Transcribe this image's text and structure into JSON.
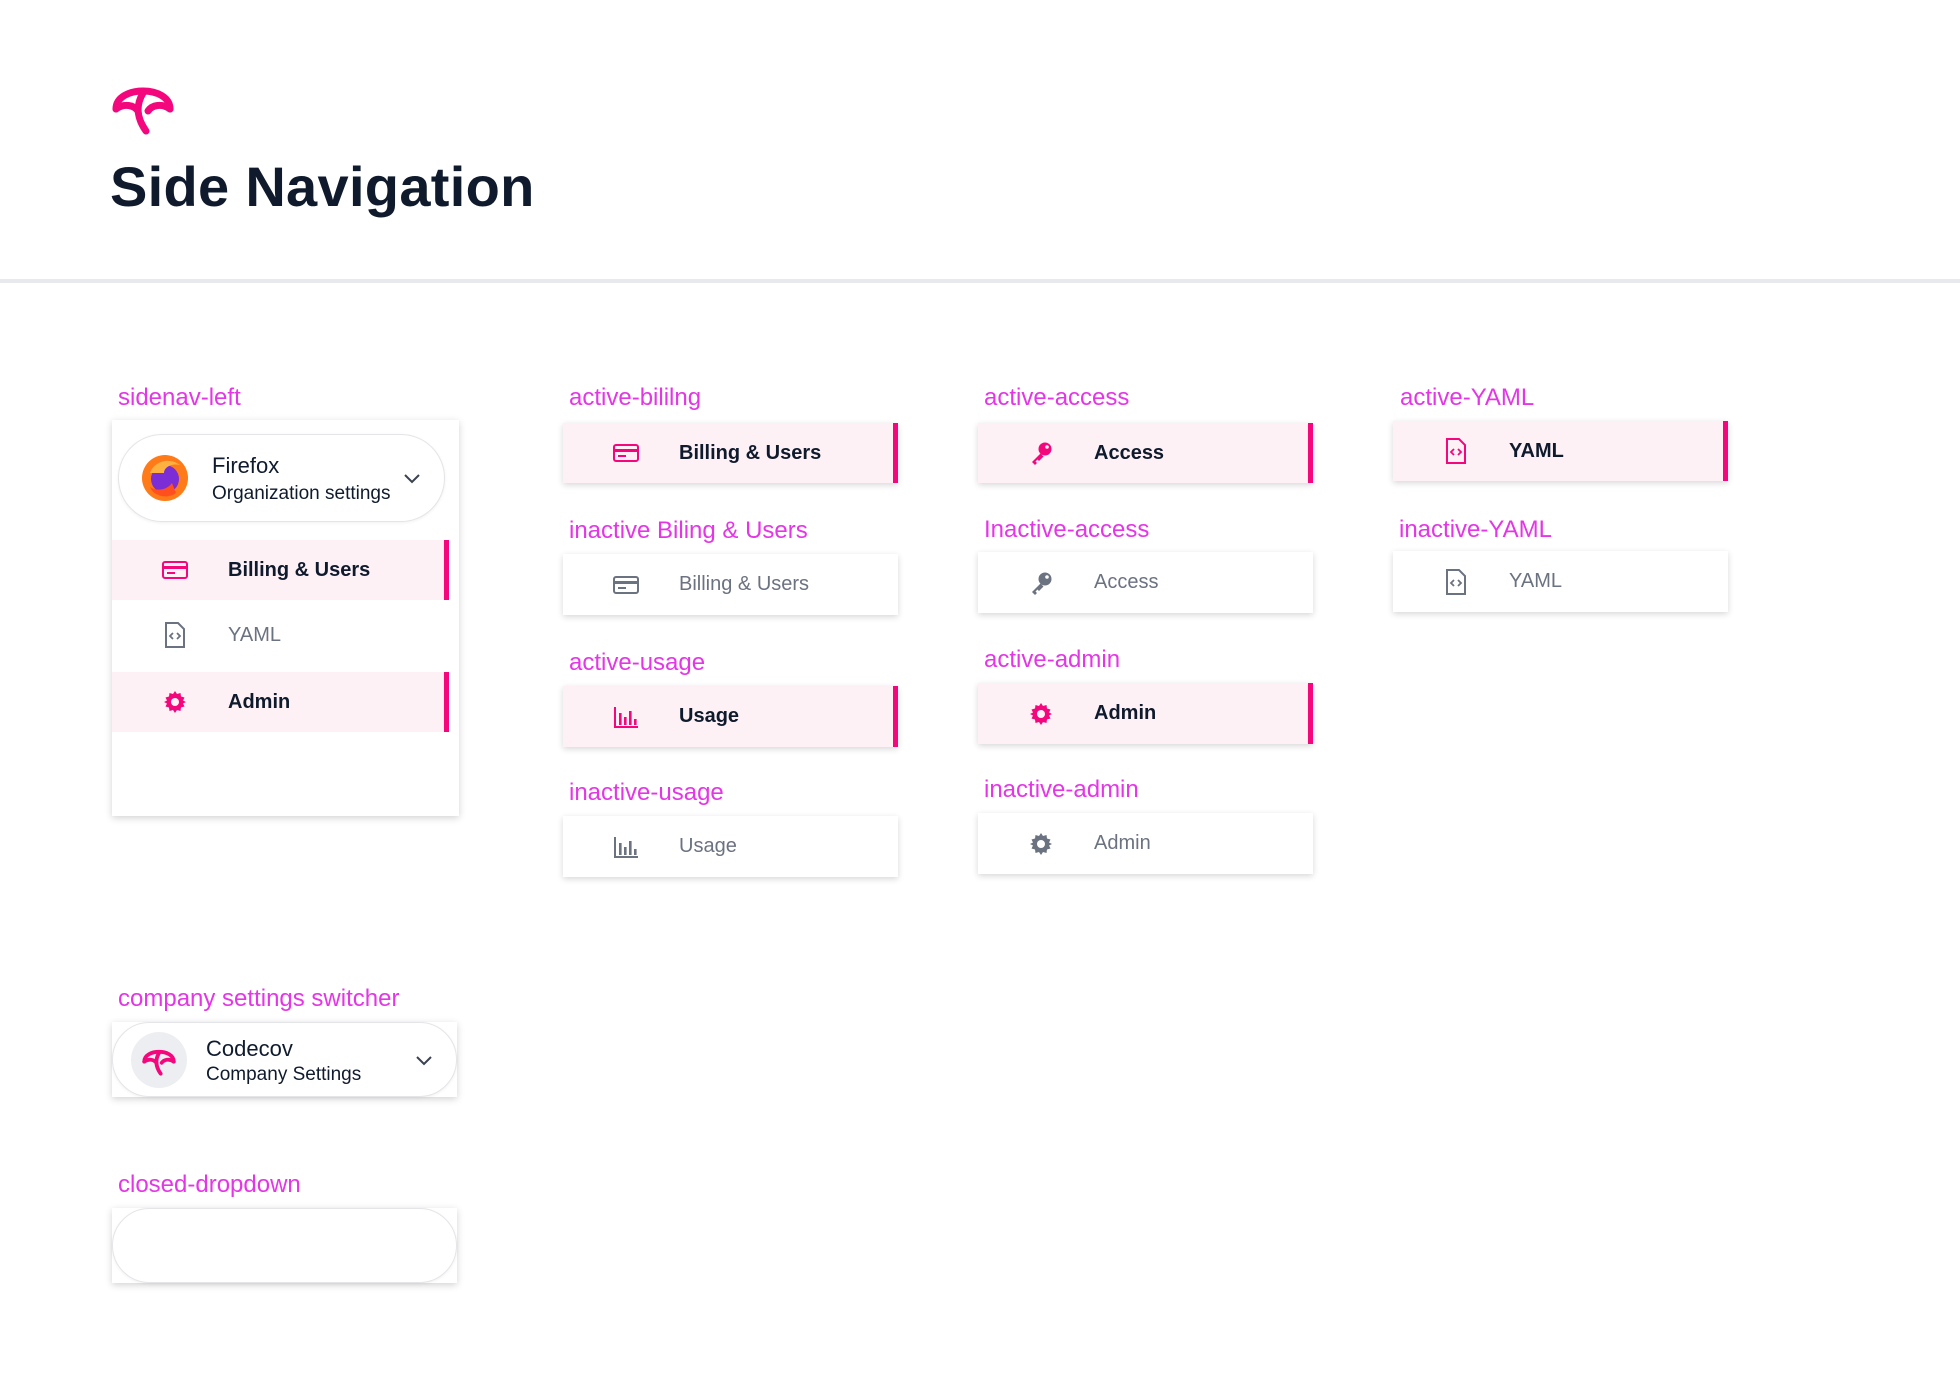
{
  "page": {
    "title": "Side Navigation"
  },
  "colors": {
    "accent": "#f4077c",
    "label": "#e436e6",
    "active_bg": "#fdf1f6",
    "text_dark": "#0f1b2d",
    "text_muted": "#6b7280"
  },
  "labels": {
    "sidenav_left": "sidenav-left",
    "active_billing": "active-bililng",
    "inactive_billing": "inactive Biling & Users",
    "active_usage": "active-usage",
    "inactive_usage": "inactive-usage",
    "active_access": "active-access",
    "inactive_access": "Inactive-access",
    "active_admin": "active-admin",
    "inactive_admin": "inactive-admin",
    "active_yaml": "active-YAML",
    "inactive_yaml": "inactive-YAML",
    "company_switcher": "company settings switcher",
    "closed_dropdown": "closed-dropdown"
  },
  "sidenav": {
    "org": {
      "name": "Firefox",
      "subtitle": "Organization settings",
      "icon": "firefox-logo"
    },
    "items": [
      {
        "label": "Billing & Users",
        "icon": "credit-card-icon",
        "state": "active"
      },
      {
        "label": "YAML",
        "icon": "code-file-icon",
        "state": "inactive"
      },
      {
        "label": "Admin",
        "icon": "gear-icon",
        "state": "active"
      }
    ]
  },
  "items": {
    "active_billing": {
      "label": "Billing & Users",
      "icon": "credit-card-icon"
    },
    "inactive_billing": {
      "label": "Billing & Users",
      "icon": "credit-card-icon"
    },
    "active_usage": {
      "label": "Usage",
      "icon": "bar-chart-icon"
    },
    "inactive_usage": {
      "label": "Usage",
      "icon": "bar-chart-icon"
    },
    "active_access": {
      "label": "Access",
      "icon": "key-icon"
    },
    "inactive_access": {
      "label": "Access",
      "icon": "key-icon"
    },
    "active_admin": {
      "label": "Admin",
      "icon": "gear-icon"
    },
    "inactive_admin": {
      "label": "Admin",
      "icon": "gear-icon"
    },
    "active_yaml": {
      "label": "YAML",
      "icon": "code-file-icon"
    },
    "inactive_yaml": {
      "label": "YAML",
      "icon": "code-file-icon"
    }
  },
  "company_switcher": {
    "name": "Codecov",
    "subtitle": "Company Settings",
    "icon": "codecov-logo"
  }
}
